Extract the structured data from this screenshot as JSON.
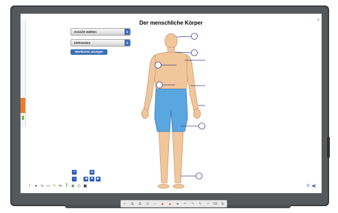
{
  "app": {
    "title": "Der menschliche Körper",
    "close_glyph": "×"
  },
  "panel": {
    "view_dropdown": {
      "value": "Ansicht wählen",
      "arrow": "⇕"
    },
    "mode_dropdown": {
      "value": "Ziehmodus",
      "arrow": "⇕"
    },
    "show_words_button": "Wortkarten anzeigen"
  },
  "navigation": {
    "up": "▲",
    "down": "▼",
    "left": "◀",
    "right": "▶",
    "zoom_in": "+",
    "zoom_out": "−"
  },
  "toolbar": {
    "tools": [
      {
        "icon": "pen-icon",
        "glyph": "/",
        "color": "dark"
      },
      {
        "icon": "color-dot-icon",
        "glyph": "●",
        "color": "blue"
      },
      {
        "icon": "line-width-icon",
        "glyph": "∿",
        "color": "dark"
      },
      {
        "icon": "shapes-icon",
        "glyph": "▭",
        "color": "dark"
      },
      {
        "icon": "highlighter-icon",
        "glyph": "✎",
        "color": "orange"
      },
      {
        "icon": "pencil-icon",
        "glyph": "✏",
        "color": "dark"
      },
      {
        "icon": "text-icon",
        "glyph": "T",
        "color": "dark"
      },
      {
        "icon": "eraser-icon",
        "glyph": "◆",
        "color": "green"
      },
      {
        "icon": "select-icon",
        "glyph": "◇",
        "color": "dark"
      },
      {
        "icon": "screen-icon",
        "glyph": "▣",
        "color": "dark"
      }
    ]
  },
  "right_tools": {
    "glyphs": [
      "⚲",
      "◀)"
    ]
  },
  "bottom_bar": {
    "items": [
      "✓",
      "⧉",
      "⧉",
      "⊡",
      "□",
      "▲",
      "▲",
      "■",
      "↶",
      "↷",
      "✎",
      "↗",
      "⌫",
      "⊞"
    ]
  },
  "colors": {
    "accent": "#3d6fb6",
    "skin": "#f2c69b",
    "shorts": "#5aa6e0",
    "frame": "#3a3d40",
    "strip": "#ee7d2a"
  }
}
